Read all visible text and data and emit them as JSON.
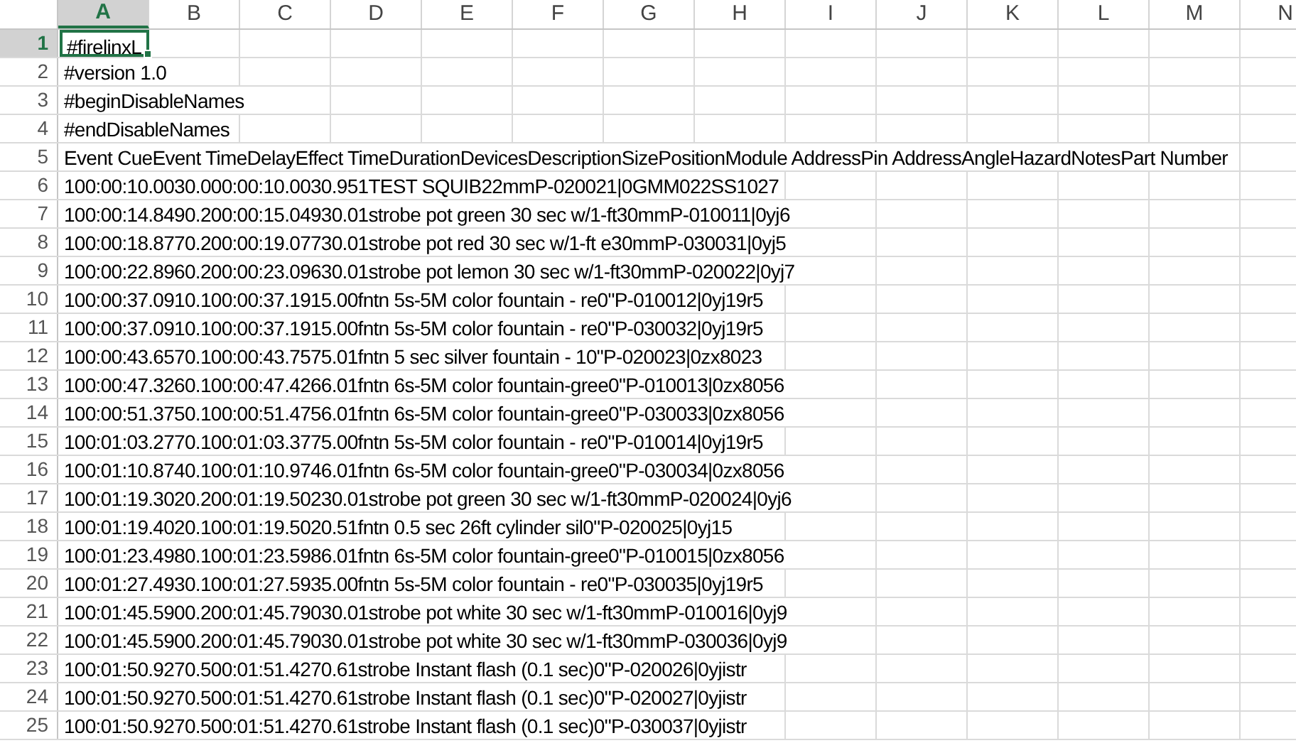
{
  "columns": [
    {
      "label": "A",
      "selected": true
    },
    {
      "label": "B",
      "selected": false
    },
    {
      "label": "C",
      "selected": false
    },
    {
      "label": "D",
      "selected": false
    },
    {
      "label": "E",
      "selected": false
    },
    {
      "label": "F",
      "selected": false
    },
    {
      "label": "G",
      "selected": false
    },
    {
      "label": "H",
      "selected": false
    },
    {
      "label": "I",
      "selected": false
    },
    {
      "label": "J",
      "selected": false
    },
    {
      "label": "K",
      "selected": false
    },
    {
      "label": "L",
      "selected": false
    },
    {
      "label": "M",
      "selected": false
    },
    {
      "label": "N",
      "selected": false
    }
  ],
  "rows": [
    {
      "number": "1",
      "selected": true,
      "text": "#firelinxL"
    },
    {
      "number": "2",
      "selected": false,
      "text": "#version 1.0"
    },
    {
      "number": "3",
      "selected": false,
      "text": "#beginDisableNames"
    },
    {
      "number": "4",
      "selected": false,
      "text": "#endDisableNames"
    },
    {
      "number": "5",
      "selected": false,
      "text": "Event CueEvent TimeDelayEffect TimeDurationDevicesDescriptionSizePositionModule AddressPin AddressAngleHazardNotesPart Number"
    },
    {
      "number": "6",
      "selected": false,
      "text": "100:00:10.0030.000:00:10.0030.951TEST SQUIB22mmP-020021|0GMM022SS1027"
    },
    {
      "number": "7",
      "selected": false,
      "text": "100:00:14.8490.200:00:15.04930.01strobe pot green 30 sec w/1-ft30mmP-010011|0yj6"
    },
    {
      "number": "8",
      "selected": false,
      "text": "100:00:18.8770.200:00:19.07730.01strobe pot red 30 sec w/1-ft e30mmP-030031|0yj5"
    },
    {
      "number": "9",
      "selected": false,
      "text": "100:00:22.8960.200:00:23.09630.01strobe pot lemon 30 sec w/1-ft30mmP-020022|0yj7"
    },
    {
      "number": "10",
      "selected": false,
      "text": "100:00:37.0910.100:00:37.1915.00fntn 5s-5M color fountain - re0\"P-010012|0yj19r5"
    },
    {
      "number": "11",
      "selected": false,
      "text": "100:00:37.0910.100:00:37.1915.00fntn 5s-5M color fountain - re0\"P-030032|0yj19r5"
    },
    {
      "number": "12",
      "selected": false,
      "text": "100:00:43.6570.100:00:43.7575.01fntn 5 sec silver fountain - 10\"P-020023|0zx8023"
    },
    {
      "number": "13",
      "selected": false,
      "text": "100:00:47.3260.100:00:47.4266.01fntn 6s-5M color fountain-gree0\"P-010013|0zx8056"
    },
    {
      "number": "14",
      "selected": false,
      "text": "100:00:51.3750.100:00:51.4756.01fntn 6s-5M color fountain-gree0\"P-030033|0zx8056"
    },
    {
      "number": "15",
      "selected": false,
      "text": "100:01:03.2770.100:01:03.3775.00fntn 5s-5M color fountain - re0\"P-010014|0yj19r5"
    },
    {
      "number": "16",
      "selected": false,
      "text": "100:01:10.8740.100:01:10.9746.01fntn 6s-5M color fountain-gree0\"P-030034|0zx8056"
    },
    {
      "number": "17",
      "selected": false,
      "text": "100:01:19.3020.200:01:19.50230.01strobe pot green 30 sec w/1-ft30mmP-020024|0yj6"
    },
    {
      "number": "18",
      "selected": false,
      "text": "100:01:19.4020.100:01:19.5020.51fntn 0.5 sec 26ft cylinder sil0\"P-020025|0yj15"
    },
    {
      "number": "19",
      "selected": false,
      "text": "100:01:23.4980.100:01:23.5986.01fntn 6s-5M color fountain-gree0\"P-010015|0zx8056"
    },
    {
      "number": "20",
      "selected": false,
      "text": "100:01:27.4930.100:01:27.5935.00fntn 5s-5M color fountain - re0\"P-030035|0yj19r5"
    },
    {
      "number": "21",
      "selected": false,
      "text": "100:01:45.5900.200:01:45.79030.01strobe pot white 30 sec w/1-ft30mmP-010016|0yj9"
    },
    {
      "number": "22",
      "selected": false,
      "text": "100:01:45.5900.200:01:45.79030.01strobe pot white 30 sec w/1-ft30mmP-030036|0yj9"
    },
    {
      "number": "23",
      "selected": false,
      "text": "100:01:50.9270.500:01:51.4270.61strobe Instant flash (0.1 sec)0\"P-020026|0yjistr"
    },
    {
      "number": "24",
      "selected": false,
      "text": "100:01:50.9270.500:01:51.4270.61strobe Instant flash (0.1 sec)0\"P-020027|0yjistr"
    },
    {
      "number": "25",
      "selected": false,
      "text": "100:01:50.9270.500:01:51.4270.61strobe Instant flash (0.1 sec)0\"P-030037|0yjistr"
    }
  ]
}
